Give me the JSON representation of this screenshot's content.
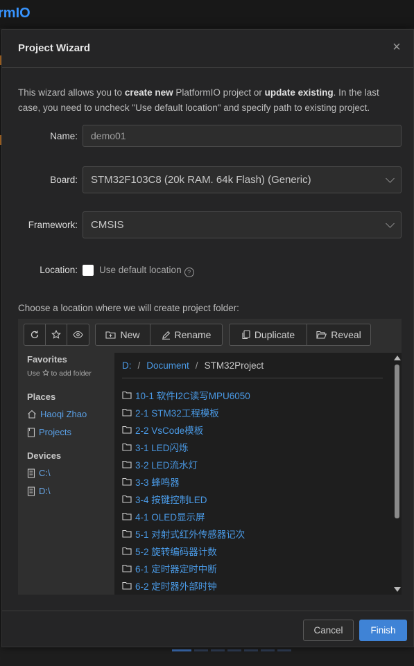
{
  "background": {
    "app_title": "rmIO"
  },
  "dialog": {
    "title": "Project Wizard",
    "close_label": "×",
    "intro_1": "This wizard allows you to ",
    "intro_bold_1": "create new",
    "intro_2": " PlatformIO project or ",
    "intro_bold_2": "update existing",
    "intro_3": ". In the last case, you need to uncheck \"Use default location\" and specify path to existing project."
  },
  "form": {
    "name_label": "Name:",
    "name_value": "demo01",
    "board_label": "Board:",
    "board_value": "STM32F103C8 (20k RAM. 64k Flash) (Generic)",
    "framework_label": "Framework:",
    "framework_value": "CMSIS",
    "location_label": "Location:",
    "use_default_label": "Use default location",
    "use_default_checked": false,
    "help_glyph": "?"
  },
  "browser": {
    "prompt": "Choose a location where we will create project folder:",
    "toolbar": {
      "new": "New",
      "rename": "Rename",
      "duplicate": "Duplicate",
      "reveal": "Reveal"
    },
    "sidebar": {
      "favorites_heading": "Favorites",
      "favorites_note_1": "Use ",
      "favorites_note_2": " to add folder",
      "places_heading": "Places",
      "places": [
        "Haoqi Zhao",
        "Projects"
      ],
      "devices_heading": "Devices",
      "devices": [
        "C:\\",
        "D:\\"
      ]
    },
    "breadcrumb": [
      "D:",
      "Document",
      "STM32Project"
    ],
    "breadcrumb_sep": "/",
    "folders": [
      "10-1 软件I2C读写MPU6050",
      "2-1 STM32工程模板",
      "2-2 VsCode模板",
      "3-1 LED闪烁",
      "3-2 LED流水灯",
      "3-3 蜂鸣器",
      "3-4 按键控制LED",
      "4-1 OLED显示屏",
      "5-1 对射式红外传感器记次",
      "5-2 旋转编码器计数",
      "6-1 定时器定时中断",
      "6-2 定时器外部时钟"
    ]
  },
  "footer": {
    "cancel": "Cancel",
    "finish": "Finish"
  },
  "colors": {
    "accent": "#3f83d6",
    "link": "#4a9ae6"
  }
}
